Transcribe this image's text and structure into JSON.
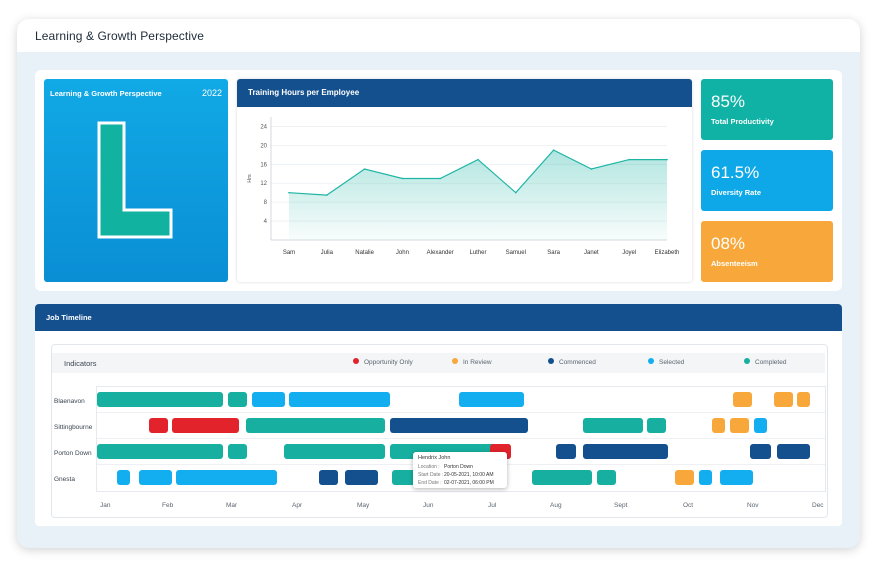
{
  "app": {
    "title": "Learning & Growth Perspective"
  },
  "summary_card": {
    "title": "Learning & Growth Perspective",
    "year": "2022",
    "letter": "L"
  },
  "training_chart": {
    "header": "Training Hours per Employee",
    "chart_data": {
      "type": "area",
      "title": "Training Hours per Employee",
      "xlabel": "",
      "ylabel": "Hrs",
      "ylim": [
        0,
        26
      ],
      "yticks": [
        4,
        8,
        12,
        16,
        20,
        24
      ],
      "categories": [
        "Sam",
        "Julia",
        "Natalie",
        "John",
        "Alexander",
        "Luther",
        "Samuel",
        "Sara",
        "Janet",
        "Joyel",
        "Elizabeth"
      ],
      "values": [
        10,
        9.5,
        15,
        13,
        13,
        17,
        10,
        19,
        15,
        17,
        17
      ],
      "grid": true,
      "line_color": "#1fb5a5"
    }
  },
  "kpis": [
    {
      "value": "85%",
      "label": "Total Productivity",
      "color": "#0fb2a4"
    },
    {
      "value": "61.5%",
      "label": "Diversity Rate",
      "color": "#0ea8e8"
    },
    {
      "value": "08%",
      "label": "Absenteeism",
      "color": "#f8a83a"
    }
  ],
  "timeline": {
    "header": "Job Timeline",
    "indicators_label": "Indicators",
    "legend": [
      {
        "label": "Opportunity Only",
        "color": "#e3232c"
      },
      {
        "label": "In Review",
        "color": "#f8a83a"
      },
      {
        "label": "Commenced",
        "color": "#14508e"
      },
      {
        "label": "Selected",
        "color": "#12aef0"
      },
      {
        "label": "Completed",
        "color": "#17b0a0"
      }
    ],
    "rows": [
      "Blaenavon",
      "Sittingbourne",
      "Porton Down",
      "Gnesta"
    ],
    "months": [
      "Jan",
      "Feb",
      "Mar",
      "Apr",
      "May",
      "Jun",
      "Jul",
      "Aug",
      "Sept",
      "Oct",
      "Nov",
      "Dec"
    ],
    "tooltip": {
      "name": "Hendrix John",
      "location_label": "Location :",
      "location": "Porton Down",
      "start_label": "Start Date :",
      "start": "20-05-2021, 10:00 AM",
      "end_label": "End Date :",
      "end": "02-07-2021, 06:00 PM"
    }
  }
}
